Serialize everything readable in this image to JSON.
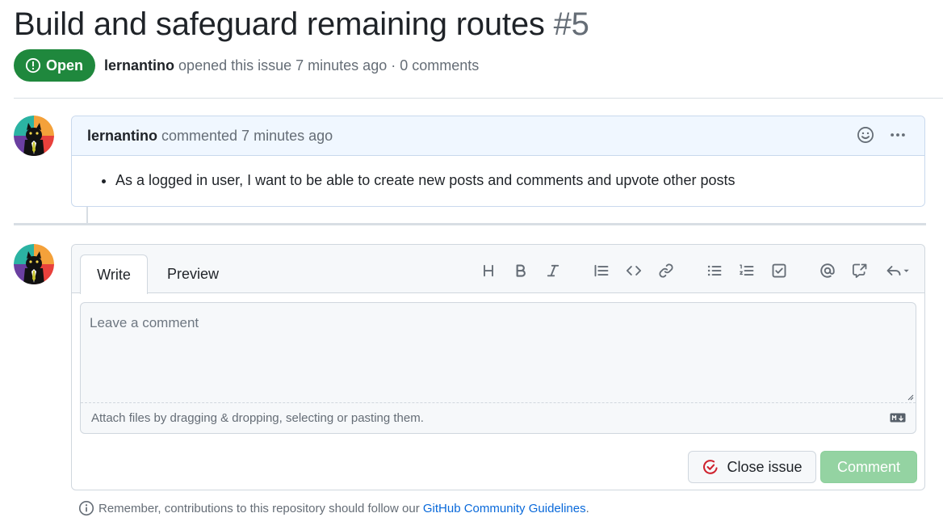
{
  "issue": {
    "title": "Build and safeguard remaining routes",
    "number": "#5",
    "state_label": "Open",
    "author": "lernantino",
    "opened_text": "opened this issue 7 minutes ago · 0 comments"
  },
  "comment": {
    "author": "lernantino",
    "time_text": "commented 7 minutes ago",
    "body_items": [
      "As a logged in user, I want to be able to create new posts and comments and upvote other posts"
    ]
  },
  "editor": {
    "tabs": [
      "Write",
      "Preview"
    ],
    "toolbar_icons": [
      "heading-icon",
      "bold-icon",
      "italic-icon",
      "quote-icon",
      "code-icon",
      "link-icon",
      "unordered-list-icon",
      "ordered-list-icon",
      "task-list-icon",
      "mention-icon",
      "cross-reference-icon",
      "saved-reply-icon"
    ],
    "placeholder": "Leave a comment",
    "attach_text": "Attach files by dragging & dropping, selecting or pasting them.",
    "close_label": "Close issue",
    "comment_label": "Comment"
  },
  "footer": {
    "note_text": "Remember, contributions to this repository should follow our ",
    "link_text": "GitHub Community Guidelines",
    "note_end": "."
  },
  "colors": {
    "open_green": "#1f883d",
    "comment_disabled": "#94d3a2",
    "close_red": "#cf222e",
    "link_blue": "#0969da"
  }
}
